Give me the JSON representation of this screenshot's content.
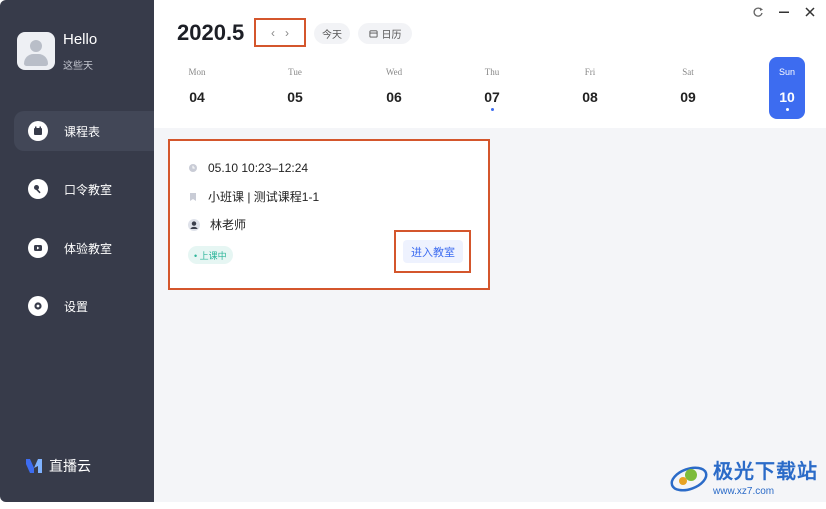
{
  "user": {
    "greeting": "Hello",
    "subtitle": "这些天"
  },
  "sidebar": {
    "items": [
      {
        "label": "课程表",
        "icon": "calendar-icon",
        "active": true
      },
      {
        "label": "口令教室",
        "icon": "key-icon",
        "active": false
      },
      {
        "label": "体验教室",
        "icon": "video-icon",
        "active": false
      },
      {
        "label": "设置",
        "icon": "gear-icon",
        "active": false
      }
    ],
    "brand": "直播云"
  },
  "header": {
    "month": "2020.5",
    "prev_label": "‹",
    "next_label": "›",
    "today_label": "今天",
    "calendar_label": "日历"
  },
  "week": [
    {
      "name": "Mon",
      "num": "04",
      "has_event": false,
      "active": false
    },
    {
      "name": "Tue",
      "num": "05",
      "has_event": false,
      "active": false
    },
    {
      "name": "Wed",
      "num": "06",
      "has_event": false,
      "active": false
    },
    {
      "name": "Thu",
      "num": "07",
      "has_event": true,
      "active": false
    },
    {
      "name": "Fri",
      "num": "08",
      "has_event": false,
      "active": false
    },
    {
      "name": "Sat",
      "num": "09",
      "has_event": false,
      "active": false
    },
    {
      "name": "Sun",
      "num": "10",
      "has_event": true,
      "active": true
    }
  ],
  "course": {
    "time": "05.10  10:23–12:24",
    "title": "小班课  |  测试课程1-1",
    "teacher": "林老师",
    "status": "• 上课中",
    "enter_label": "进入教室"
  },
  "watermark": {
    "name": "极光下载站",
    "url": "www.xz7.com"
  },
  "colors": {
    "accent": "#3d6cf0",
    "sidebar": "#373b4a",
    "highlight": "#d4562c",
    "status": "#2cb59a"
  }
}
